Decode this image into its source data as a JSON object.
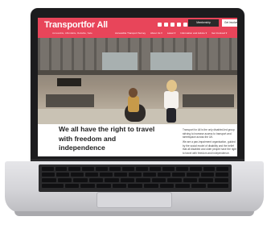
{
  "site": {
    "brand_prefix": "Transport",
    "brand_suffix": "for All",
    "tagline": "Accessible, Affordable, Reliable, Safe",
    "membership_button": "Membership",
    "get_involved_button": "Get Involved",
    "nav": [
      "Accessible Transport Survey",
      "About Us ▾",
      "Latest ▾",
      "Information and Advice ▾",
      "Get Involved ▾"
    ]
  },
  "hero": {
    "headline": "We all have the right to travel with freedom and independence",
    "paragraph_1": "Transport for All is the only disabled-led group striving to increase access to transport and streetspace across the UK.",
    "paragraph_2": "We are a pan-impairment organisation, guided by the social model of disability and the belief that all disabled and older people have the right to travel with freedom and independence."
  },
  "colors": {
    "brand": "#e8455a",
    "laptop_bezel": "#1c1c1e",
    "laptop_body": "#d4d4d8"
  }
}
